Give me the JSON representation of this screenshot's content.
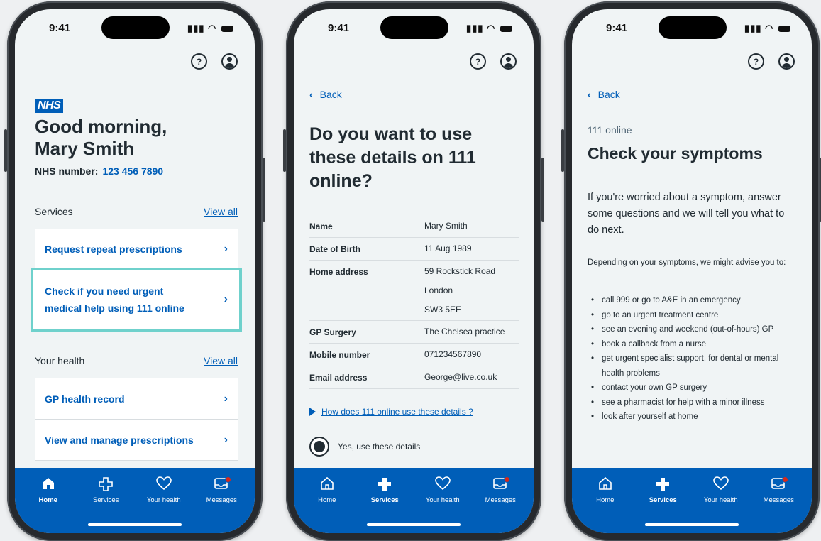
{
  "status": {
    "time": "9:41"
  },
  "tabbar": [
    {
      "label": "Home",
      "icon": "home-icon"
    },
    {
      "label": "Services",
      "icon": "plus-icon"
    },
    {
      "label": "Your health",
      "icon": "heart-icon"
    },
    {
      "label": "Messages",
      "icon": "messages-icon"
    }
  ],
  "phone1": {
    "logo": "NHS",
    "greeting_line1": "Good morning,",
    "greeting_line2": "Mary Smith",
    "nhs_number_label": "NHS number:",
    "nhs_number": "123 456 7890",
    "services": {
      "heading": "Services",
      "view_all": "View all",
      "items": [
        "Request repeat prescriptions",
        "Check if you need urgent medical help using 111 online"
      ]
    },
    "health": {
      "heading": "Your health",
      "view_all": "View all",
      "items": [
        "GP health record",
        "View and manage prescriptions"
      ]
    },
    "highlight_color": "#6fd1cc"
  },
  "phone2": {
    "back": "Back",
    "heading": "Do you want to use these details on 111 online?",
    "details": [
      {
        "label": "Name",
        "value": [
          "Mary Smith"
        ]
      },
      {
        "label": "Date of Birth",
        "value": [
          "11 Aug 1989"
        ]
      },
      {
        "label": "Home address",
        "value": [
          "59 Rockstick Road",
          "London",
          "SW3 5EE"
        ]
      },
      {
        "label": "GP Surgery",
        "value": [
          "The Chelsea practice"
        ]
      },
      {
        "label": "Mobile number",
        "value": [
          "071234567890"
        ]
      },
      {
        "label": "Email address",
        "value": [
          "George@live.co.uk"
        ]
      }
    ],
    "expander": "How does 111 online use these details ?",
    "radio_label": "Yes, use these details"
  },
  "phone3": {
    "back": "Back",
    "caption": "111 online",
    "heading": "Check your symptoms",
    "lead": "If you're worried about a symptom, answer some questions and we will tell you what to do next.",
    "intro": "Depending on your symptoms, we might advise you to:",
    "bullets": [
      "call 999 or go to A&E in an emergency",
      "go to an urgent treatment centre",
      "see an evening and weekend (out-of-hours) GP",
      "book a callback from a nurse",
      "get urgent specialist support, for dental or mental health problems",
      "contact your own GP surgery",
      "see a pharmacist for help with a minor illness",
      "look after yourself at home"
    ]
  },
  "colors": {
    "nhs_blue": "#005eb8",
    "text": "#212b32",
    "background": "#f0f4f5"
  }
}
